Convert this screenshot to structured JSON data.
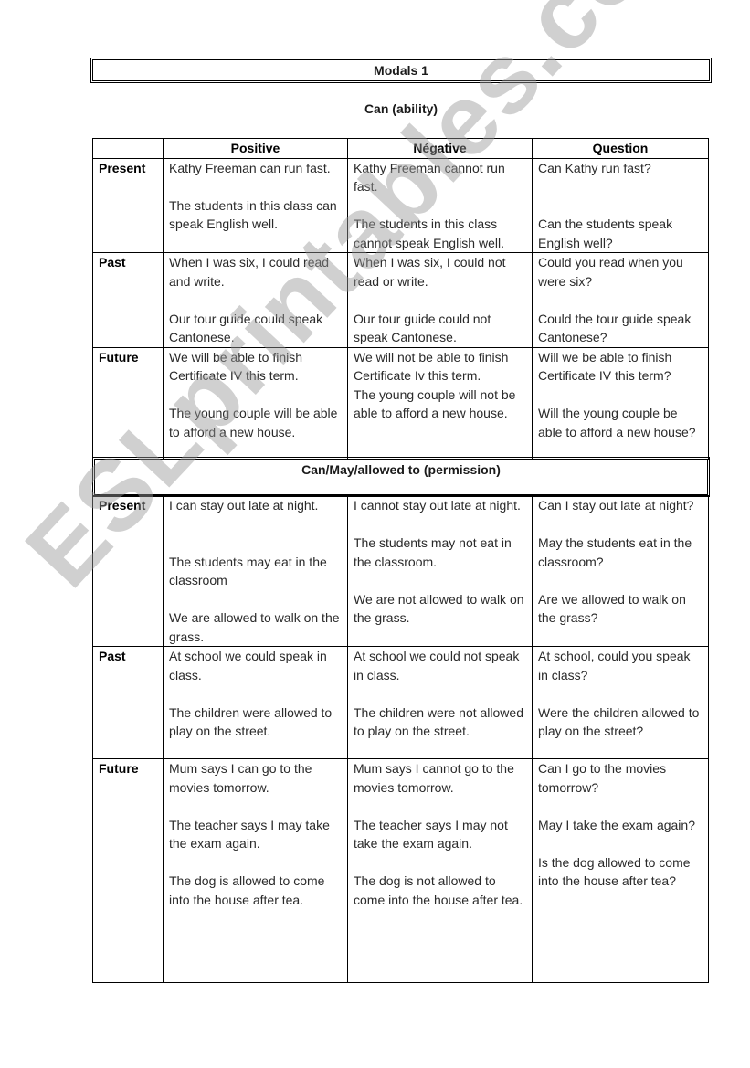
{
  "title": "Modals 1",
  "section1": {
    "heading": "Can (ability)",
    "columns": [
      "",
      "Positive",
      "Négative",
      "Question"
    ],
    "rows": [
      {
        "label": "Present",
        "positive": [
          "Kathy Freeman can run fast.",
          "The students in this class can speak English well."
        ],
        "negative": [
          "Kathy Freeman cannot run fast.",
          "The students in this class cannot speak English well."
        ],
        "question": [
          "Can Kathy run fast?",
          "Can the students speak English well?"
        ]
      },
      {
        "label": "Past",
        "positive": [
          "When I was six, I could read and write.",
          "Our tour guide could speak Cantonese."
        ],
        "negative": [
          "When I was six, I could not read or write.",
          "Our tour guide could not speak Cantonese."
        ],
        "question": [
          "Could you read when you were six?",
          "Could the tour guide speak Cantonese?"
        ]
      },
      {
        "label": "Future",
        "positive": [
          "We will be able to finish Certificate IV this term.",
          "The young couple will be able to afford a new house."
        ],
        "negative": [
          "We will not be able to finish Certificate Iv this term.",
          "The young couple will not be able to afford a new house."
        ],
        "question": [
          "Will we be able to finish Certificate IV this term?",
          "Will the young couple be able to afford a new house?"
        ]
      }
    ]
  },
  "section2": {
    "heading": "Can/May/allowed to (permission)",
    "rows": [
      {
        "label": "Present",
        "positive": [
          "I can stay out late at night.",
          "The students may eat in the classroom",
          "We are allowed to walk on the grass."
        ],
        "negative": [
          "I cannot stay out late at night.",
          "The students may not eat in the classroom.",
          "We are not allowed to walk on the grass."
        ],
        "question": [
          "Can I stay out late at night?",
          "May the students eat in the classroom?",
          "Are we allowed to walk on the grass?"
        ]
      },
      {
        "label": "Past",
        "positive": [
          "At school we could speak in class.",
          "The children were allowed to play on the street."
        ],
        "negative": [
          "At school we could not speak in class.",
          "The children were not allowed to play on the street."
        ],
        "question": [
          "At school, could you speak in class?",
          "Were the children allowed to play on the street?"
        ]
      },
      {
        "label": "Future",
        "positive": [
          "Mum says I can go to the movies tomorrow.",
          "The teacher says I may take the exam again.",
          "The dog is allowed to come into the house after tea."
        ],
        "negative": [
          "Mum says I cannot go to the movies tomorrow.",
          "The teacher says I may not take the exam again.",
          "The dog is not allowed to come into the house after tea."
        ],
        "question": [
          "Can I go to the movies tomorrow?",
          "May I take the exam again?",
          "Is the dog allowed to come into the house after tea?"
        ]
      }
    ]
  },
  "watermark": "ESLprintables.com"
}
